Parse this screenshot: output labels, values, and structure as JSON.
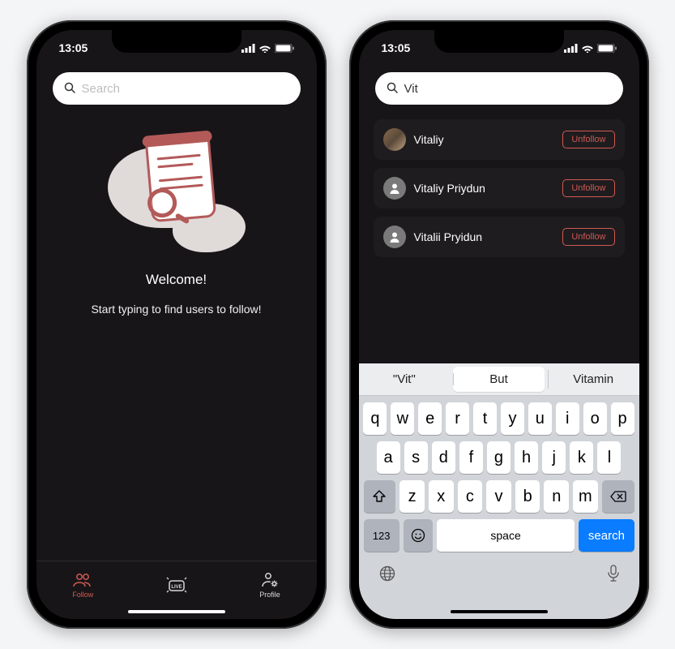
{
  "status": {
    "time": "13:05"
  },
  "search": {
    "placeholder": "Search",
    "value": "Vit"
  },
  "empty": {
    "title": "Welcome!",
    "subtitle": "Start typing to find users to follow!"
  },
  "results": [
    {
      "name": "Vitaliy",
      "action": "Unfollow",
      "avatarType": "image"
    },
    {
      "name": "Vitaliy Priydun",
      "action": "Unfollow",
      "avatarType": "placeholder"
    },
    {
      "name": "Vitalii Pryidun",
      "action": "Unfollow",
      "avatarType": "placeholder"
    }
  ],
  "tabs": {
    "follow": "Follow",
    "profile": "Profile"
  },
  "keyboard": {
    "suggestions": [
      "\"Vit\"",
      "But",
      "Vitamin"
    ],
    "row1": [
      "q",
      "w",
      "e",
      "r",
      "t",
      "y",
      "u",
      "i",
      "o",
      "p"
    ],
    "row2": [
      "a",
      "s",
      "d",
      "f",
      "g",
      "h",
      "j",
      "k",
      "l"
    ],
    "row3": [
      "z",
      "x",
      "c",
      "v",
      "b",
      "n",
      "m"
    ],
    "space": "space",
    "search": "search",
    "mode": "123"
  },
  "colors": {
    "accent": "#cf5a52",
    "bgDark": "#181518"
  }
}
